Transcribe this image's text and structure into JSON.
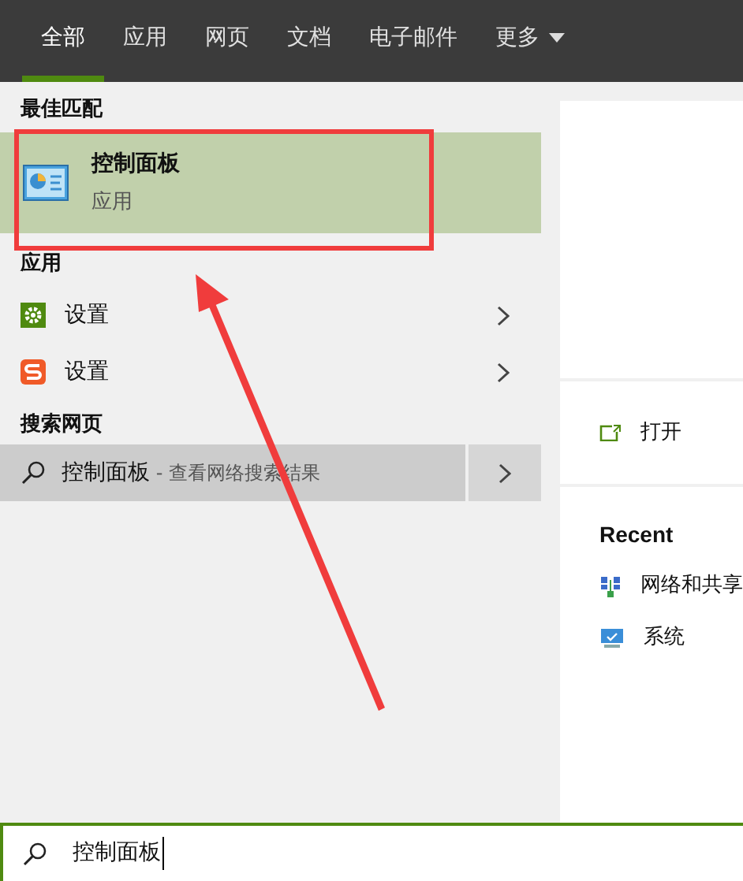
{
  "tabs": [
    {
      "label": "全部",
      "selected": true
    },
    {
      "label": "应用",
      "selected": false
    },
    {
      "label": "网页",
      "selected": false
    },
    {
      "label": "文档",
      "selected": false
    },
    {
      "label": "电子邮件",
      "selected": false
    },
    {
      "label": "更多",
      "selected": false,
      "dropdown": true
    }
  ],
  "best_match": {
    "heading": "最佳匹配",
    "title": "控制面板",
    "subtitle": "应用",
    "selected": true
  },
  "apps": {
    "heading": "应用",
    "items": [
      {
        "label": "设置",
        "kind": "gear"
      },
      {
        "label": "设置",
        "kind": "sogou"
      }
    ]
  },
  "web": {
    "heading": "搜索网页",
    "query": "控制面板",
    "suffix": " - 查看网络搜索结果",
    "selected": true
  },
  "details": {
    "actions": [
      {
        "label": "打开"
      }
    ],
    "recent_heading": "Recent",
    "recent": [
      {
        "label": "网络和共享",
        "kind": "network"
      },
      {
        "label": "系统",
        "kind": "monitor"
      }
    ]
  },
  "search": {
    "value": "控制面板"
  }
}
